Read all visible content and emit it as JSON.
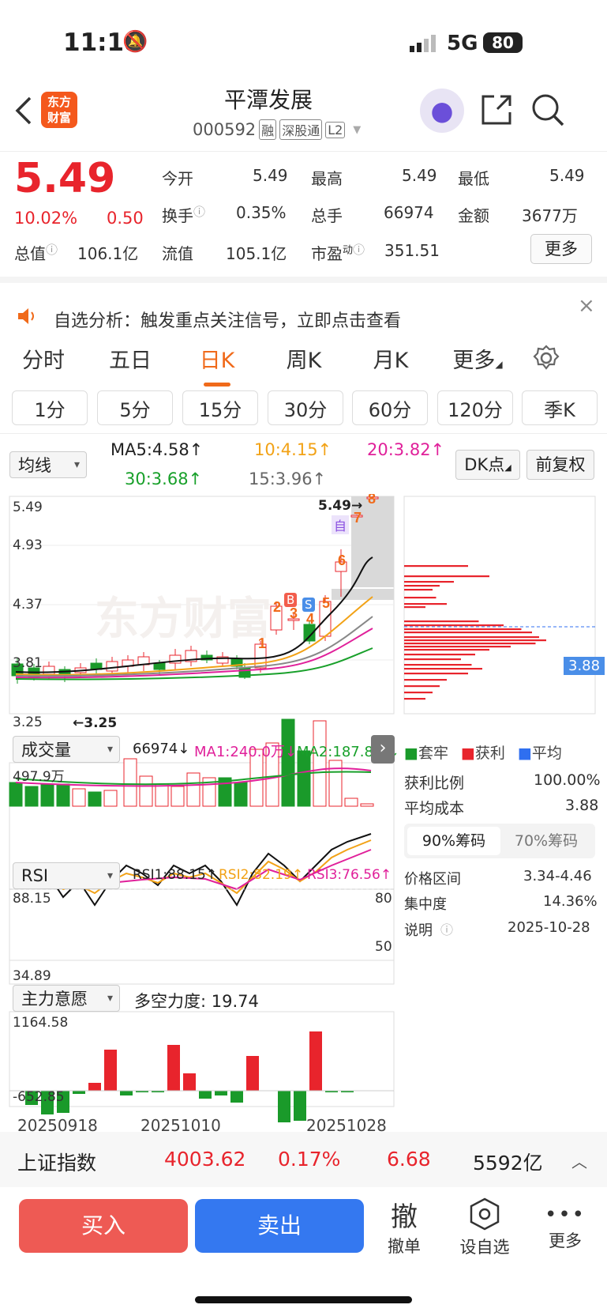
{
  "status_bar": {
    "time": "11:18",
    "network": "5G",
    "battery": "80"
  },
  "header": {
    "logo_line1": "东方",
    "logo_line2": "财富",
    "title": "平潭发展",
    "code": "000592",
    "tag1": "融",
    "tag2": "深股通",
    "tag3": "L2"
  },
  "quote": {
    "price": "5.49",
    "pct": "10.02%",
    "chg": "0.50",
    "open_label": "今开",
    "open": "5.49",
    "high_label": "最高",
    "high": "5.49",
    "low_label": "最低",
    "low": "5.49",
    "turnover_label": "换手",
    "turnover": "0.35%",
    "vol_label": "总手",
    "vol": "66974",
    "amount_label": "金额",
    "amount": "3677万",
    "mktcap_label": "总值",
    "mktcap": "106.1亿",
    "float_label": "流值",
    "float": "105.1亿",
    "pe_label": "市盈",
    "pe_sup": "动",
    "pe": "351.51",
    "more_btn": "更多"
  },
  "notice": {
    "text": "自选分析：触发重点关注信号，立即点击查看"
  },
  "tabs": [
    "分时",
    "五日",
    "日K",
    "周K",
    "月K",
    "更多"
  ],
  "active_tab": "日K",
  "periods": [
    "1分",
    "5分",
    "15分",
    "30分",
    "60分",
    "120分",
    "季K"
  ],
  "ma": {
    "selector": "均线",
    "ma5": "MA5:4.58↑",
    "ma10": "10:4.15↑",
    "ma20": "20:3.82↑",
    "ma30": "30:3.68↑",
    "ma15": "15:3.96↑",
    "dk_btn": "DK点",
    "fq_btn": "前复权"
  },
  "kline": {
    "y_labels": [
      "5.49",
      "4.93",
      "4.37",
      "3.81",
      "3.25"
    ],
    "high_mark": "5.49→",
    "low_mark": "←3.25",
    "watermark": "东方财富",
    "zi_mark": "自",
    "b_mark": "B",
    "s_mark": "S"
  },
  "volume": {
    "selector": "成交量",
    "val": "66974↓",
    "ma1": "MA1:240.0万↓",
    "ma2": "MA2:187.8万↓",
    "max": "497.9万"
  },
  "rsi": {
    "selector": "RSI",
    "rsi1": "RSI1:88.15↑",
    "rsi2": "RSI2:82.19↑",
    "rsi3": "RSI3:76.56↑",
    "max": "88.15",
    "min": "34.89",
    "l80": "80",
    "l50": "50"
  },
  "force": {
    "selector": "主力意愿",
    "label": "多空力度: 19.74",
    "max": "1164.58",
    "min": "-652.85"
  },
  "dates": [
    "20250918",
    "20251010",
    "20251028"
  ],
  "chips": {
    "legend": [
      "套牢",
      "获利",
      "平均"
    ],
    "avg_price": "3.88",
    "profit_label": "获利比例",
    "profit": "100.00%",
    "cost_label": "平均成本",
    "cost": "3.88",
    "tab90": "90%筹码",
    "tab70": "70%筹码",
    "range_label": "价格区间",
    "range": "3.34-4.46",
    "conc_label": "集中度",
    "conc": "14.36%",
    "note_label": "说明",
    "note": "2025-10-28"
  },
  "index_bar": {
    "name": "上证指数",
    "value": "4003.62",
    "pct": "0.17%",
    "chg": "6.68",
    "amount": "5592亿"
  },
  "bottom": {
    "buy": "买入",
    "sell": "卖出",
    "cancel_glyph": "撤",
    "cancel": "撤单",
    "watch": "设自选",
    "more": "更多"
  },
  "colors": {
    "up": "#e8242c",
    "down": "#1a9a2a",
    "accent": "#f06a1a",
    "sell_blue": "#2f6ff0"
  }
}
